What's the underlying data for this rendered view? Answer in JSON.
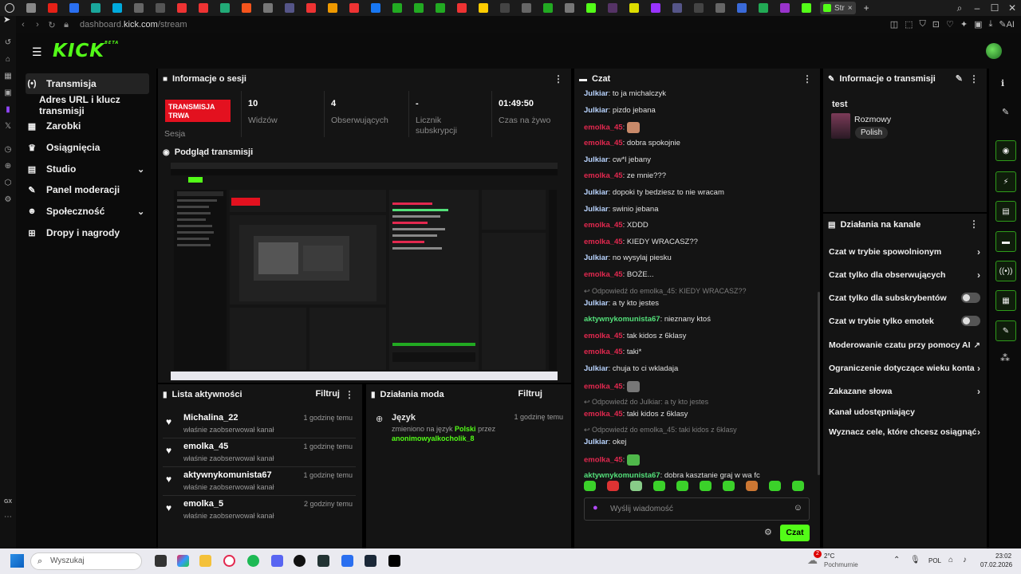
{
  "browser": {
    "active_tab_label": "Str",
    "url_prefix": "dashboard.",
    "url_host": "kick.com",
    "url_path": "/stream",
    "ai_label": "AI"
  },
  "opera_sidebar": {
    "gx_label": "GX"
  },
  "kick": {
    "logo": "KICK",
    "logo_sup": "BETA"
  },
  "nav": {
    "items": [
      {
        "icon": "(•)",
        "label": "Transmisja"
      },
      {
        "icon": "",
        "label": "Adres URL i klucz transmisji"
      },
      {
        "icon": "▦",
        "label": "Zarobki"
      },
      {
        "icon": "♛",
        "label": "Osiągnięcia"
      },
      {
        "icon": "▤",
        "label": "Studio"
      },
      {
        "icon": "✎",
        "label": "Panel moderacji"
      },
      {
        "icon": "☻",
        "label": "Społeczność"
      },
      {
        "icon": "⊞",
        "label": "Dropy i nagrody"
      }
    ]
  },
  "session": {
    "title": "Informacje o sesji",
    "live_badge": "TRANSMISJA TRWA",
    "session_label": "Sesja",
    "stats": [
      {
        "value": "10",
        "label": "Widzów"
      },
      {
        "value": "4",
        "label": "Obserwujących"
      },
      {
        "value": "-",
        "label": "Licznik subskrypcji"
      },
      {
        "value": "01:49:50",
        "label": "Czas na żywo"
      }
    ]
  },
  "preview": {
    "title": "Podgląd transmisji"
  },
  "activity": {
    "title": "Lista aktywności",
    "filter": "Filtruj",
    "rows": [
      {
        "name": "Michalina_22",
        "sub": "właśnie zaobserwował kanał",
        "time": "1 godzinę temu"
      },
      {
        "name": "emolka_45",
        "sub": "właśnie zaobserwował kanał",
        "time": "1 godzinę temu"
      },
      {
        "name": "aktywnykomunista67",
        "sub": "właśnie zaobserwował kanał",
        "time": "1 godzinę temu"
      },
      {
        "name": "emolka_5",
        "sub": "właśnie zaobserwował kanał",
        "time": "2 godziny temu"
      }
    ]
  },
  "modactions": {
    "title": "Działania moda",
    "filter": "Filtruj",
    "item_title": "Język",
    "item_time": "1 godzinę temu",
    "item_text1": "zmieniono na język ",
    "item_lang": "Polski",
    "item_text2": " przez",
    "item_user": "anonimowyalkocholik_8"
  },
  "chat": {
    "title": "Czat",
    "messages": [
      {
        "user": "Julkiar",
        "color": "#b9d4ff",
        "text": "to ja michalczyk"
      },
      {
        "user": "Julkiar",
        "color": "#b9d4ff",
        "text": "pizdo jebana"
      },
      {
        "user": "emolka_45",
        "color": "#e3284f",
        "text": "",
        "emote": "#c98a6a"
      },
      {
        "user": "emolka_45",
        "color": "#e3284f",
        "text": "dobra spokojnie"
      },
      {
        "user": "Julkiar",
        "color": "#b9d4ff",
        "text": "cw*l jebany"
      },
      {
        "user": "emolka_45",
        "color": "#e3284f",
        "text": "ze mnie???"
      },
      {
        "user": "Julkiar",
        "color": "#b9d4ff",
        "text": "dopoki ty bedziesz to nie wracam"
      },
      {
        "user": "Julkiar",
        "color": "#b9d4ff",
        "text": "swinio jebana"
      },
      {
        "user": "emolka_45",
        "color": "#e3284f",
        "text": "XDDD"
      },
      {
        "user": "emolka_45",
        "color": "#e3284f",
        "text": "KIEDY WRACASZ??"
      },
      {
        "user": "Julkiar",
        "color": "#b9d4ff",
        "text": "no wysylaj piesku"
      },
      {
        "user": "emolka_45",
        "color": "#e3284f",
        "text": "BOŻE..."
      },
      {
        "reply": "Odpowiedź do emolka_45: KIEDY WRACASZ??"
      },
      {
        "user": "Julkiar",
        "color": "#b9d4ff",
        "text": "a ty kto jestes"
      },
      {
        "user": "aktywnykomunista67",
        "color": "#53e07a",
        "text": "nieznany ktoś"
      },
      {
        "user": "emolka_45",
        "color": "#e3284f",
        "text": "tak kidos z 6klasy"
      },
      {
        "user": "emolka_45",
        "color": "#e3284f",
        "text": "taki*"
      },
      {
        "user": "Julkiar",
        "color": "#b9d4ff",
        "text": "chuja to ci wkladaja"
      },
      {
        "user": "emolka_45",
        "color": "#e3284f",
        "text": "",
        "emote": "#777777"
      },
      {
        "reply": "Odpowiedź do Julkiar: a ty kto jestes"
      },
      {
        "user": "emolka_45",
        "color": "#e3284f",
        "text": "taki kidos z 6klasy"
      },
      {
        "reply": "Odpowiedź do emolka_45: taki kidos z 6klasy"
      },
      {
        "user": "Julkiar",
        "color": "#b9d4ff",
        "text": "okej"
      },
      {
        "user": "emolka_45",
        "color": "#e3284f",
        "text": "",
        "emote": "#4fb84a"
      },
      {
        "user": "aktywnykomunista67",
        "color": "#53e07a",
        "text": "dobra kasztanie graj w wa fc"
      }
    ],
    "input_placeholder": "Wyślij wiadomość",
    "send": "Czat"
  },
  "stream_info": {
    "title": "Informacje o transmisji",
    "stream_title": "test",
    "category": "Rozmowy",
    "language": "Polish"
  },
  "channel_actions": {
    "title": "Działania na kanale",
    "rows": [
      {
        "label": "Czat w trybie spowolnionym",
        "kind": "arrow"
      },
      {
        "label": "Czat tylko dla obserwujących",
        "kind": "arrow"
      },
      {
        "label": "Czat tylko dla subskrybentów",
        "kind": "toggle"
      },
      {
        "label": "Czat w trybie tylko emotek",
        "kind": "toggle"
      },
      {
        "label": "Moderowanie czatu przy pomocy AI",
        "kind": "external"
      },
      {
        "label": "Ograniczenie dotyczące wieku konta",
        "kind": "arrow"
      },
      {
        "label": "Zakazane słowa",
        "kind": "arrow"
      },
      {
        "label": "Kanał udostępniający",
        "kind": "none"
      },
      {
        "label": "Wyznacz cele, które chcesz osiągnąć",
        "kind": "arrow"
      }
    ]
  },
  "taskbar": {
    "search_placeholder": "Wyszukaj",
    "weather_temp": "2°C",
    "weather_desc": "Pochmurnie",
    "lang": "POL",
    "time": "23:02",
    "date": "07.02.2026",
    "notif_count": "2"
  }
}
